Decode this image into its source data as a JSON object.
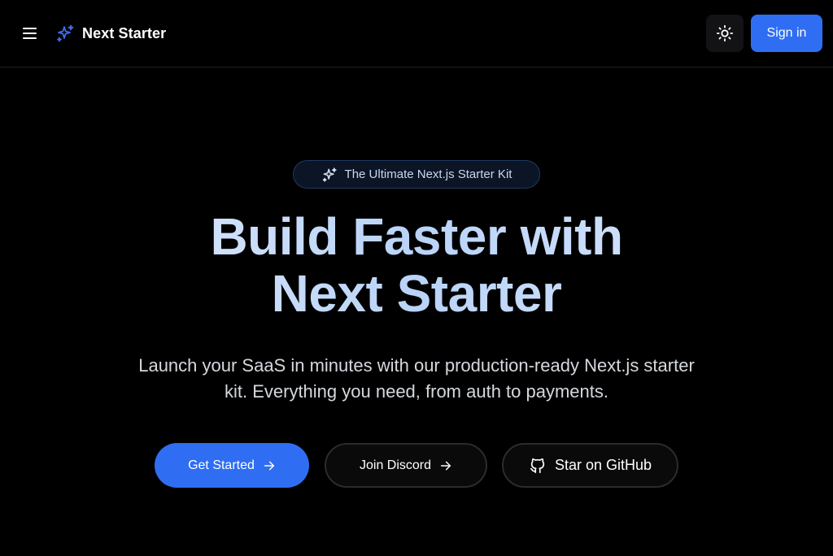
{
  "header": {
    "brand_name": "Next Starter",
    "sign_in_label": "Sign in",
    "menu_icon": "hamburger-menu-icon",
    "brand_icon": "sparkles-icon",
    "theme_icon": "sun-icon"
  },
  "hero": {
    "badge_text": "The Ultimate Next.js Starter Kit",
    "badge_icon": "sparkles-icon",
    "title_line1": "Build Faster with",
    "title_line2": "Next Starter",
    "subtitle_line1": "Launch your SaaS in minutes with our production-ready Next.js starter",
    "subtitle_line2": "kit. Everything you need, from auth to payments.",
    "buttons": [
      {
        "label": "Get Started",
        "icon": "arrow-right-icon"
      },
      {
        "label": "Join Discord",
        "icon": "arrow-right-icon"
      },
      {
        "label": "Star on GitHub",
        "icon": "github-icon"
      }
    ]
  },
  "colors": {
    "background": "#000000",
    "accent": "#2f6ef2",
    "title_gradient": "#cfe0fb",
    "badge_border": "#1e3a63"
  }
}
